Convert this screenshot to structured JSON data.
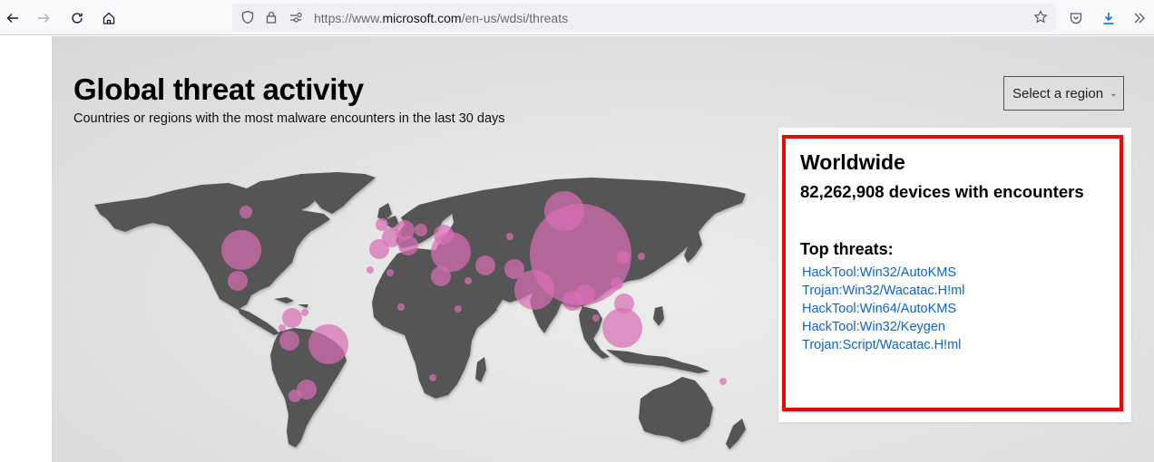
{
  "browser": {
    "url_prefix": "https://www.",
    "url_domain": "microsoft.com",
    "url_path": "/en-us/wdsi/threats",
    "icons": [
      "back-icon",
      "forward-icon",
      "reload-icon",
      "home-icon",
      "shield-icon",
      "lock-icon",
      "permissions-icon",
      "bookmark-star-icon",
      "pocket-icon",
      "download-icon",
      "overflow-chevrons-icon"
    ]
  },
  "page": {
    "title": "Global threat activity",
    "subtitle": "Countries or regions with the most malware encounters in the last 30 days",
    "region_select": {
      "label": "Select a region",
      "chevron": "⌄"
    }
  },
  "panel": {
    "region": "Worldwide",
    "count_text": "82,262,908 devices with encounters",
    "top_threats_label": "Top threats:",
    "threats": [
      "HackTool:Win32/AutoKMS",
      "Trojan:Win32/Wacatac.H!ml",
      "HackTool:Win64/AutoKMS",
      "HackTool:Win32/Keygen",
      "Trojan:Script/Wacatac.H!ml"
    ],
    "highlight_color": "#e00b0b",
    "link_color": "#0f64c4"
  },
  "map": {
    "land_color": "#555555",
    "bubble_color": "#d86fb4",
    "bubbles": [
      {
        "region": "United States",
        "size": "large"
      },
      {
        "region": "Mexico",
        "size": "medium"
      },
      {
        "region": "Canada",
        "size": "small"
      },
      {
        "region": "Brazil",
        "size": "large"
      },
      {
        "region": "Colombia",
        "size": "medium"
      },
      {
        "region": "Venezuela",
        "size": "tiny"
      },
      {
        "region": "Ecuador",
        "size": "tiny"
      },
      {
        "region": "Peru",
        "size": "medium"
      },
      {
        "region": "Argentina",
        "size": "medium"
      },
      {
        "region": "Chile",
        "size": "small"
      },
      {
        "region": "United Kingdom",
        "size": "small"
      },
      {
        "region": "France",
        "size": "medium"
      },
      {
        "region": "Spain",
        "size": "medium"
      },
      {
        "region": "Germany",
        "size": "medium"
      },
      {
        "region": "Italy",
        "size": "medium"
      },
      {
        "region": "Poland",
        "size": "small"
      },
      {
        "region": "Ukraine",
        "size": "medium"
      },
      {
        "region": "Turkey",
        "size": "large"
      },
      {
        "region": "Egypt",
        "size": "medium"
      },
      {
        "region": "Saudi Arabia",
        "size": "tiny"
      },
      {
        "region": "Iran",
        "size": "medium"
      },
      {
        "region": "Pakistan",
        "size": "medium"
      },
      {
        "region": "India",
        "size": "large"
      },
      {
        "region": "Russia",
        "size": "large"
      },
      {
        "region": "Kazakhstan",
        "size": "tiny"
      },
      {
        "region": "China",
        "size": "huge"
      },
      {
        "region": "Japan",
        "size": "tiny"
      },
      {
        "region": "South Korea",
        "size": "small"
      },
      {
        "region": "Taiwan",
        "size": "small"
      },
      {
        "region": "Vietnam",
        "size": "medium"
      },
      {
        "region": "Thailand",
        "size": "medium"
      },
      {
        "region": "Philippines",
        "size": "medium"
      },
      {
        "region": "Indonesia",
        "size": "large"
      },
      {
        "region": "Malaysia",
        "size": "tiny"
      },
      {
        "region": "Morocco",
        "size": "tiny"
      },
      {
        "region": "Algeria",
        "size": "tiny"
      },
      {
        "region": "Nigeria",
        "size": "tiny"
      },
      {
        "region": "Ethiopia",
        "size": "tiny"
      },
      {
        "region": "South Africa",
        "size": "tiny"
      },
      {
        "region": "Australia",
        "size": "tiny"
      }
    ]
  }
}
